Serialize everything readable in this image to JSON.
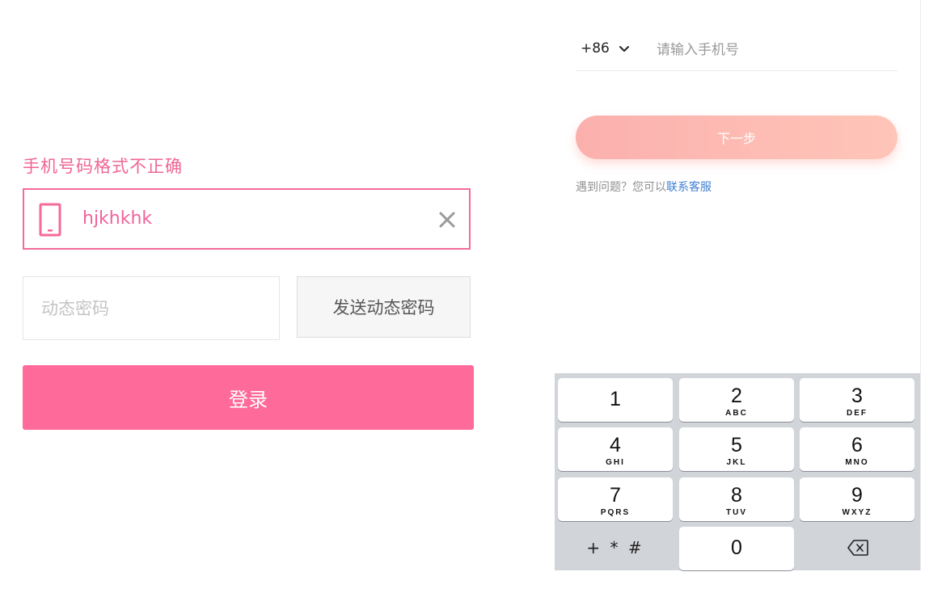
{
  "left_form": {
    "error_message": "手机号码格式不正确",
    "phone_value": "hjkhkhk",
    "code_placeholder": "动态密码",
    "send_code_label": "发送动态密码",
    "login_label": "登录",
    "colors": {
      "accent": "#fe6b9a",
      "error": "#f06595"
    }
  },
  "right_form": {
    "country_code": "+86",
    "phone_placeholder": "请输入手机号",
    "next_label": "下一步",
    "help_text": "遇到问题？您可以",
    "help_link": "联系客服"
  },
  "keypad": {
    "keys": [
      {
        "num": "1",
        "letters": ""
      },
      {
        "num": "2",
        "letters": "ABC"
      },
      {
        "num": "3",
        "letters": "DEF"
      },
      {
        "num": "4",
        "letters": "GHI"
      },
      {
        "num": "5",
        "letters": "JKL"
      },
      {
        "num": "6",
        "letters": "MNO"
      },
      {
        "num": "7",
        "letters": "PQRS"
      },
      {
        "num": "8",
        "letters": "TUV"
      },
      {
        "num": "9",
        "letters": "WXYZ"
      }
    ],
    "symbols_label": "+ * #",
    "zero": "0",
    "delete_icon": "backspace-icon"
  }
}
